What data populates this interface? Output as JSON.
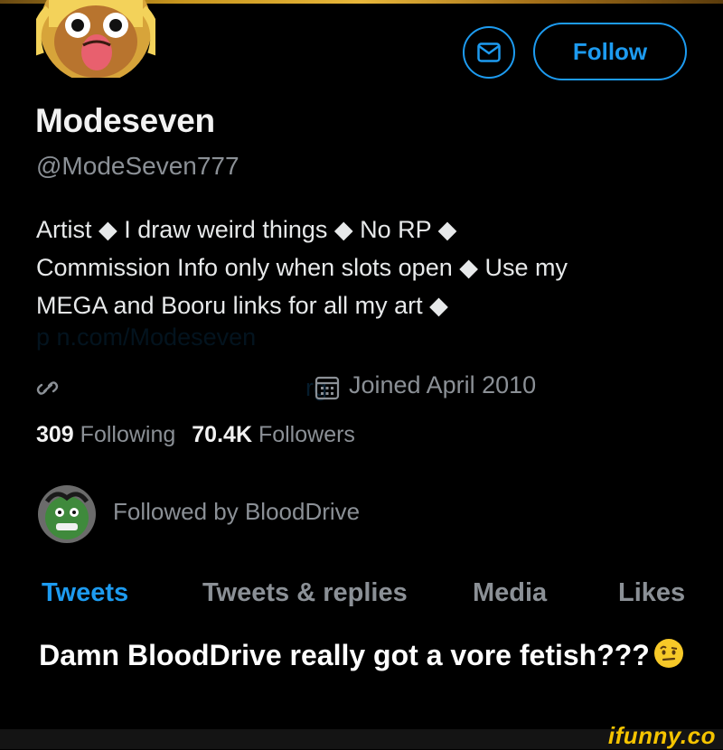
{
  "profile": {
    "name": "Modeseven",
    "handle": "@ModeSeven777",
    "bio_lines": [
      "Artist ◆ I draw weird things ◆ No RP ◆",
      "Commission Info only when slots open ◆ Use my",
      "MEGA and Booru links for all my art ◆"
    ],
    "faded_link": "p      n.com/Modeseven",
    "faded_site": "rg",
    "joined": "Joined April 2010",
    "following_count": "309",
    "following_label": "Following",
    "followers_count": "70.4K",
    "followers_label": "Followers",
    "followed_by": "Followed by BloodDrive"
  },
  "actions": {
    "follow_label": "Follow",
    "message_icon": "envelope-icon"
  },
  "tabs": [
    {
      "label": "Tweets",
      "active": true
    },
    {
      "label": "Tweets & replies",
      "active": false
    },
    {
      "label": "Media",
      "active": false
    },
    {
      "label": "Likes",
      "active": false
    }
  ],
  "caption": {
    "text": "Damn BloodDrive really got a vore fetish???",
    "emoji": "raised-eyebrow-face-icon"
  },
  "watermark": "ifunny.co",
  "colors": {
    "accent": "#1d9bf0",
    "background": "#000000",
    "secondary_text": "#8b9096",
    "watermark": "#f5c400"
  }
}
